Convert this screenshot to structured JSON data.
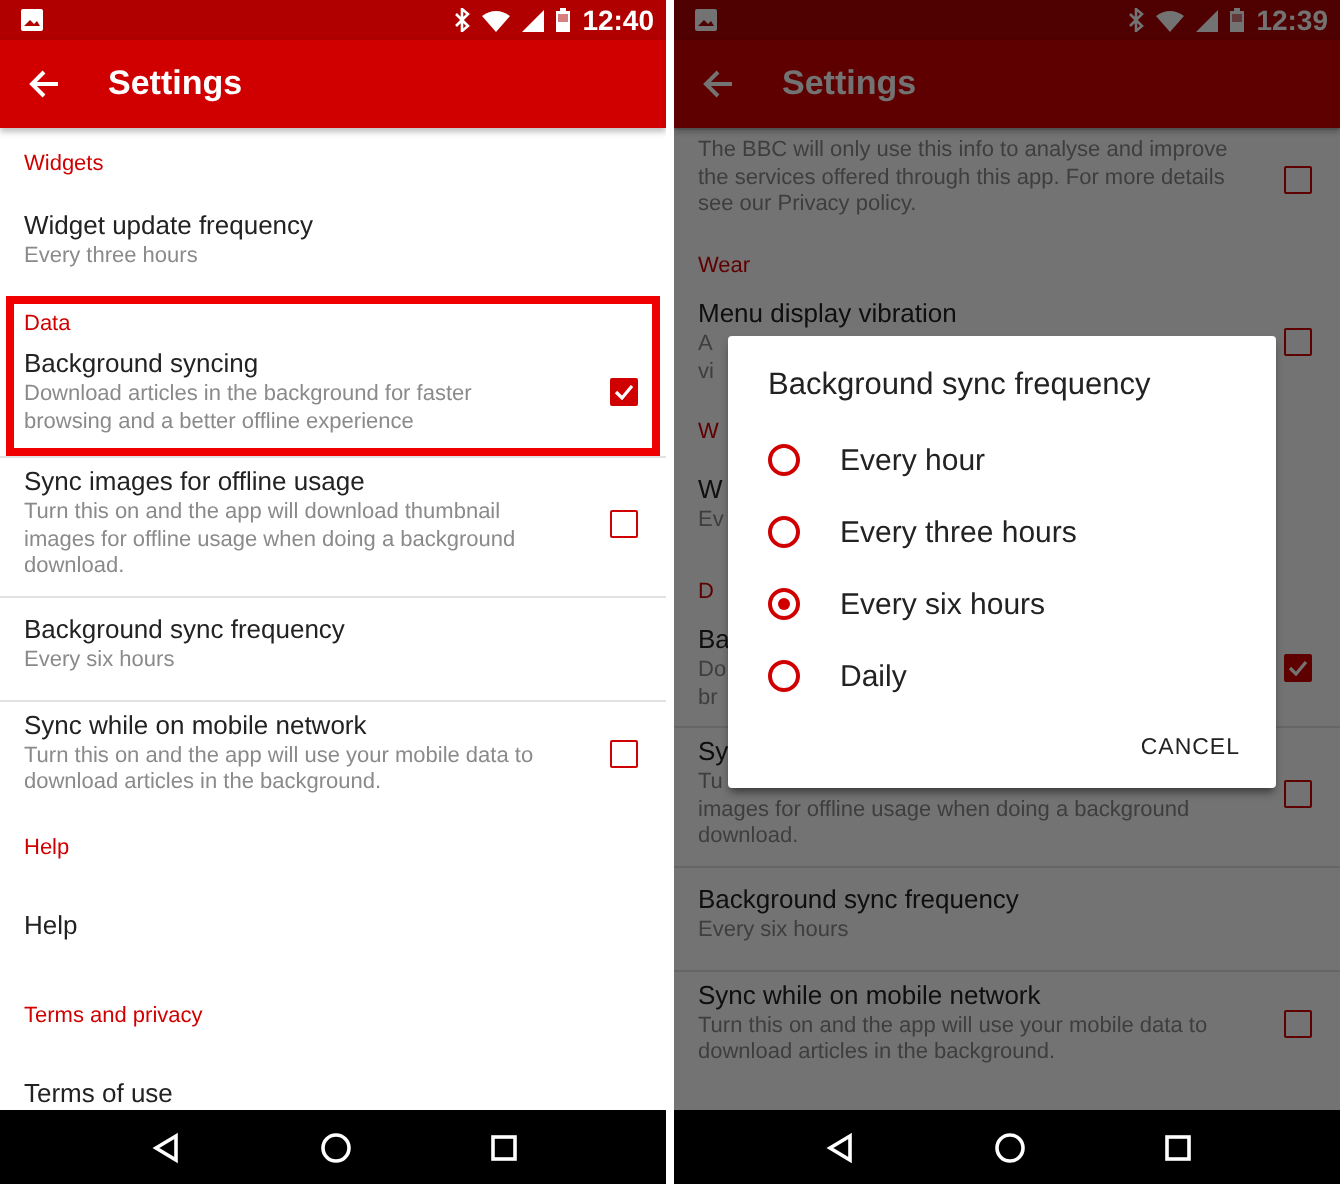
{
  "screens": [
    {
      "status_bar": {
        "time": "12:40"
      },
      "app_bar": {
        "title": "Settings"
      },
      "sections": [
        {
          "header": "Widgets",
          "items": [
            {
              "title": "Widget update frequency",
              "lines": [
                "Every three hours"
              ]
            }
          ]
        },
        {
          "header": "Data",
          "highlighted": true,
          "items": [
            {
              "title": "Background syncing",
              "lines": [
                "Download articles in the background for faster",
                "browsing and a better offline experience"
              ],
              "checked": true
            }
          ]
        },
        {
          "items": [
            {
              "title": "Sync images for offline usage",
              "lines": [
                "Turn this on and the app will download thumbnail",
                "images for offline usage when doing a background",
                "download."
              ],
              "checked": false
            },
            {
              "title": "Background sync frequency",
              "lines": [
                "Every six hours"
              ]
            },
            {
              "title": "Sync while on mobile network",
              "lines": [
                "Turn this on and the app will use your mobile data to",
                "download articles in the background."
              ],
              "checked": false
            }
          ]
        },
        {
          "header": "Help",
          "items": [
            {
              "title": "Help"
            }
          ]
        },
        {
          "header": "Terms and privacy",
          "items": [
            {
              "title": "Terms of use"
            }
          ]
        }
      ]
    },
    {
      "status_bar": {
        "time": "12:39"
      },
      "app_bar": {
        "title": "Settings"
      },
      "sections": [
        {
          "items": [
            {
              "lines": [
                "The BBC will only use this info to analyse and improve",
                "the services offered through this app. For more details",
                "see our Privacy policy."
              ],
              "checked": false
            }
          ]
        },
        {
          "header": "Wear",
          "items": [
            {
              "title": "Menu display vibration",
              "lines": [
                "A",
                "vi"
              ],
              "checked": false
            }
          ]
        },
        {
          "header": "W",
          "items": [
            {
              "title": "W",
              "lines": [
                "Ev"
              ]
            }
          ]
        },
        {
          "header": "D",
          "items": [
            {
              "title": "Ba",
              "lines": [
                "Do",
                "br"
              ],
              "checked": true
            }
          ]
        },
        {
          "items": [
            {
              "title": "Sy",
              "lines": [
                "Tu",
                "images for offline usage when doing a background",
                "download."
              ],
              "checked": false
            },
            {
              "title": "Background sync frequency",
              "lines": [
                "Every six hours"
              ]
            },
            {
              "title": "Sync while on mobile network",
              "lines": [
                "Turn this on and the app will use your mobile data to",
                "download articles in the background."
              ],
              "checked": false
            }
          ]
        }
      ],
      "dialog": {
        "title": "Background sync frequency",
        "options": [
          {
            "label": "Every hour",
            "selected": false
          },
          {
            "label": "Every three hours",
            "selected": false
          },
          {
            "label": "Every six hours",
            "selected": true
          },
          {
            "label": "Daily",
            "selected": false
          }
        ],
        "button": "CANCEL"
      }
    }
  ]
}
